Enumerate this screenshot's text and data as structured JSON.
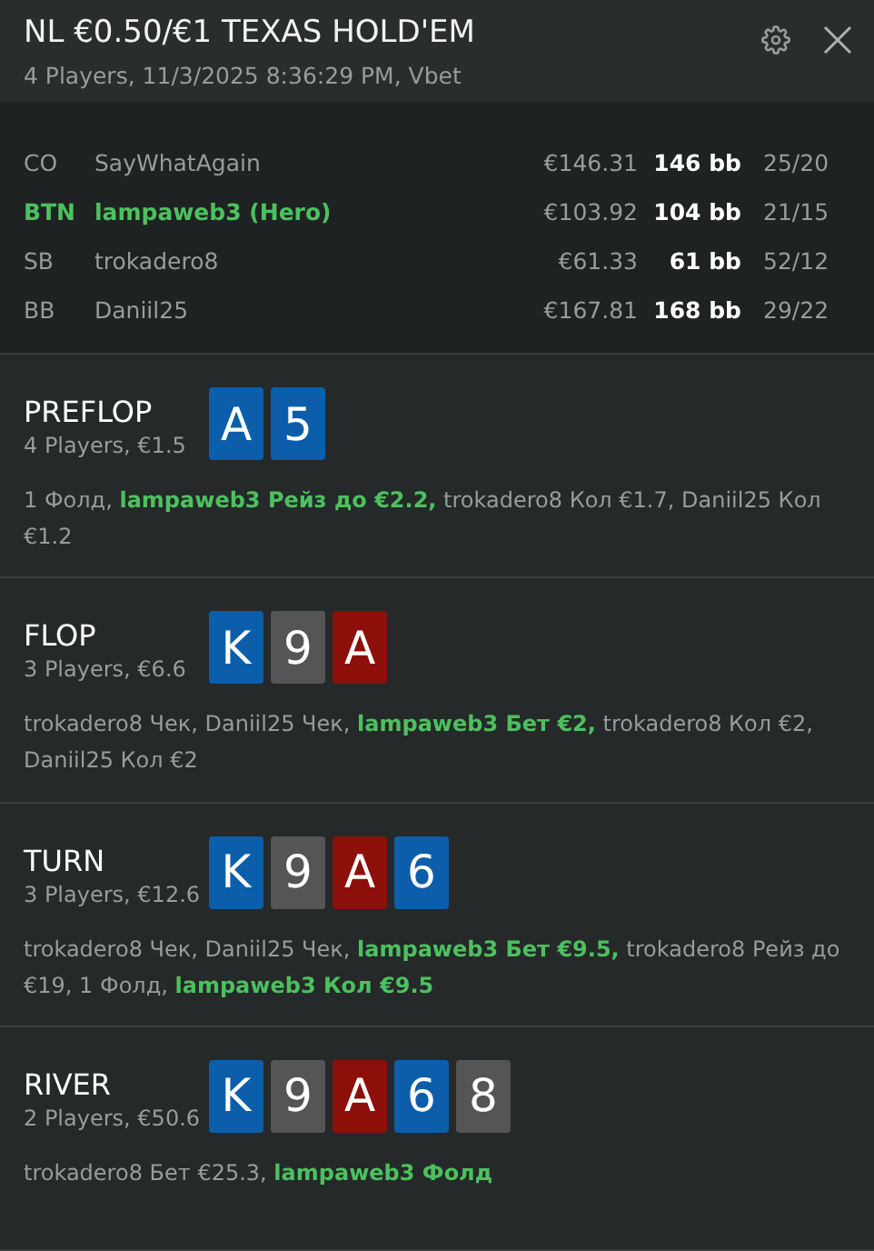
{
  "header": {
    "title": "NL €0.50/€1 TEXAS HOLD'EM",
    "subtitle": "4 Players, 11/3/2025 8:36:29 PM, Vbet"
  },
  "players": [
    {
      "position": "CO",
      "name": "SayWhatAgain",
      "stack": "€146.31",
      "bb": "146 bb",
      "stats": "25/20",
      "hero": false
    },
    {
      "position": "BTN",
      "name": "lampaweb3 (Hero)",
      "stack": "€103.92",
      "bb": "104 bb",
      "stats": "21/15",
      "hero": true
    },
    {
      "position": "SB",
      "name": "trokadero8",
      "stack": "€61.33",
      "bb": "61 bb",
      "stats": "52/12",
      "hero": false
    },
    {
      "position": "BB",
      "name": "Daniil25",
      "stack": "€167.81",
      "bb": "168 bb",
      "stats": "29/22",
      "hero": false
    }
  ],
  "streets": [
    {
      "name": "PREFLOP",
      "info": "4 Players, €1.5",
      "cards": [
        {
          "rank": "A",
          "color": "#0c5eab"
        },
        {
          "rank": "5",
          "color": "#0c5eab"
        }
      ],
      "actions": "1 Фолд, **lampaweb3 Рейз до €2.2,** trokadero8 Кол €1.7, Daniil25 Кол €1.2"
    },
    {
      "name": "FLOP",
      "info": "3 Players, €6.6",
      "cards": [
        {
          "rank": "K",
          "color": "#0c5eab"
        },
        {
          "rank": "9",
          "color": "#555555"
        },
        {
          "rank": "A",
          "color": "#8d0f0a"
        }
      ],
      "actions": "trokadero8 Чек, Daniil25 Чек, **lampaweb3 Бет €2,** trokadero8 Кол €2, Daniil25 Кол €2"
    },
    {
      "name": "TURN",
      "info": "3 Players, €12.6",
      "cards": [
        {
          "rank": "K",
          "color": "#0c5eab"
        },
        {
          "rank": "9",
          "color": "#555555"
        },
        {
          "rank": "A",
          "color": "#8d0f0a"
        },
        {
          "rank": "6",
          "color": "#0c5eab"
        }
      ],
      "actions": "trokadero8 Чек, Daniil25 Чек, **lampaweb3 Бет €9.5,** trokadero8 Рейз до €19, 1 Фолд, **lampaweb3 Кол €9.5**"
    },
    {
      "name": "RIVER",
      "info": "2 Players, €50.6",
      "cards": [
        {
          "rank": "K",
          "color": "#0c5eab"
        },
        {
          "rank": "9",
          "color": "#555555"
        },
        {
          "rank": "A",
          "color": "#8d0f0a"
        },
        {
          "rank": "6",
          "color": "#0c5eab"
        },
        {
          "rank": "8",
          "color": "#555555"
        }
      ],
      "actions": "trokadero8 Бет €25.3, **lampaweb3 Фолд**"
    }
  ]
}
